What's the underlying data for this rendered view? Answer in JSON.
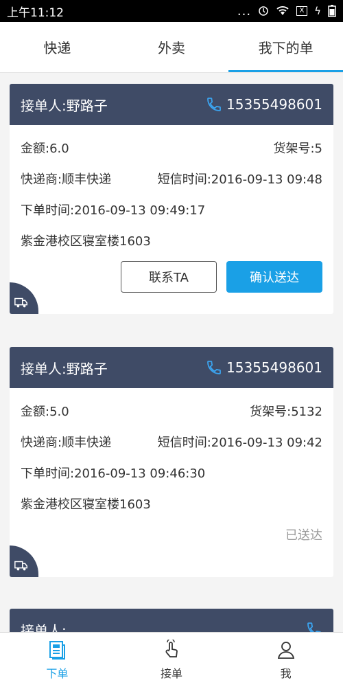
{
  "status": {
    "time": "上午11:12",
    "dots": "...",
    "battery": "X",
    "charge": "ϟ"
  },
  "tabs": [
    {
      "label": "快递",
      "active": false
    },
    {
      "label": "外卖",
      "active": false
    },
    {
      "label": "我下的单",
      "active": true
    }
  ],
  "orders": [
    {
      "courier": "接单人:野路子",
      "phone": "15355498601",
      "amount": "金额:6.0",
      "shelf": "货架号:5",
      "company": "快递商:顺丰快递",
      "sms_time": "短信时间:2016-09-13 09:48",
      "order_time": "下单时间:2016-09-13 09:49:17",
      "address": "紫金港校区寝室楼1603",
      "contact_label": "联系TA",
      "confirm_label": "确认送达"
    },
    {
      "courier": "接单人:野路子",
      "phone": "15355498601",
      "amount": "金额:5.0",
      "shelf": "货架号:5132",
      "company": "快递商:顺丰快递",
      "sms_time": "短信时间:2016-09-13 09:42",
      "order_time": "下单时间:2016-09-13 09:46:30",
      "address": "紫金港校区寝室楼1603",
      "status_label": "已送达"
    },
    {
      "courier": "接单人:"
    }
  ],
  "bottom_nav": [
    {
      "label": "下单",
      "active": true
    },
    {
      "label": "接单",
      "active": false
    },
    {
      "label": "我",
      "active": false
    }
  ],
  "colors": {
    "accent": "#1aa0e6",
    "header": "#3f4b66",
    "muted": "#999999"
  }
}
